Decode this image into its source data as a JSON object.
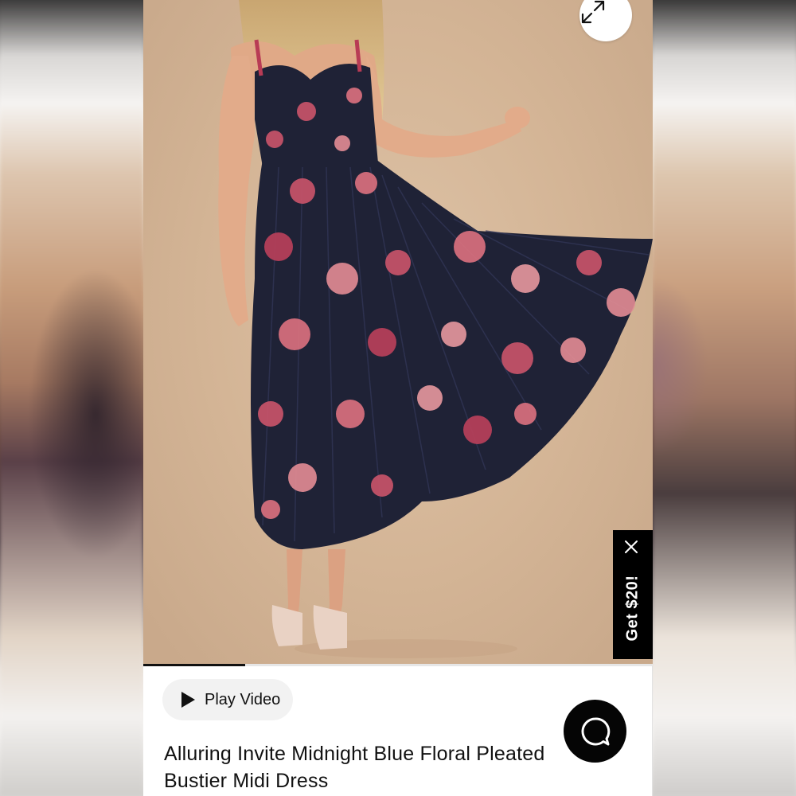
{
  "product": {
    "title": "Alluring Invite Midnight Blue Floral Pleated Bustier Midi Dress",
    "image_alt": "Model wearing a midnight blue floral pleated bustier midi dress"
  },
  "gallery": {
    "progress_fraction": 0.2,
    "expand_icon": "expand-arrows-icon"
  },
  "video": {
    "play_label": "Play Video",
    "icon": "play-icon"
  },
  "promo": {
    "label": "Get $20!",
    "close_icon": "close-icon"
  },
  "chat": {
    "icon": "chat-bubble-icon"
  },
  "colors": {
    "accent": "#000000",
    "photo_bg": "#d4b596",
    "dress_navy": "#1f2236",
    "rose_pink": "#c8536a"
  }
}
